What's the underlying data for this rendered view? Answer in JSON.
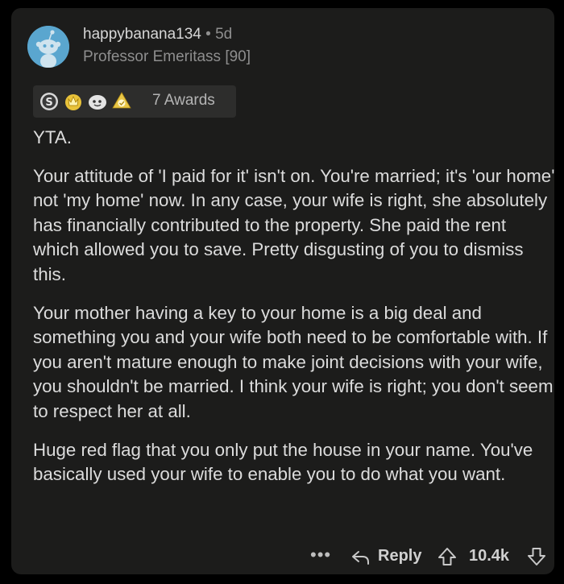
{
  "comment": {
    "username": "happybanana134",
    "separator": "•",
    "age": "5d",
    "flair": "Professor Emeritass [90]",
    "awards_label": "7 Awards",
    "award_icons": [
      "silver-award-icon",
      "gold-crown-award-icon",
      "wholesome-face-award-icon",
      "helpful-award-icon"
    ],
    "paragraphs": [
      "YTA.",
      "Your attitude of 'I paid for it' isn't on. You're married; it's 'our home' not 'my home' now. In any case, your wife is right, she absolutely has financially contributed to the property. She paid the rent which allowed you to save. Pretty disgusting of you to dismiss this.",
      "Your mother having a key to your home is a big deal and something you and your wife both need to be comfortable with. If you aren't mature enough to make joint decisions with your wife, you shouldn't be married. I think your wife is right; you don't seem to respect her at all.",
      "Huge red flag that you only put the house in your name. You've basically used your wife to enable you to do what you want."
    ]
  },
  "actions": {
    "more_label": "•••",
    "reply_label": "Reply",
    "score": "10.4k"
  },
  "colors": {
    "background": "#000000",
    "card": "#1c1c1b",
    "avatar": "#5aa6cf",
    "text": "#dcdcdc",
    "muted": "#8e8e8e"
  }
}
